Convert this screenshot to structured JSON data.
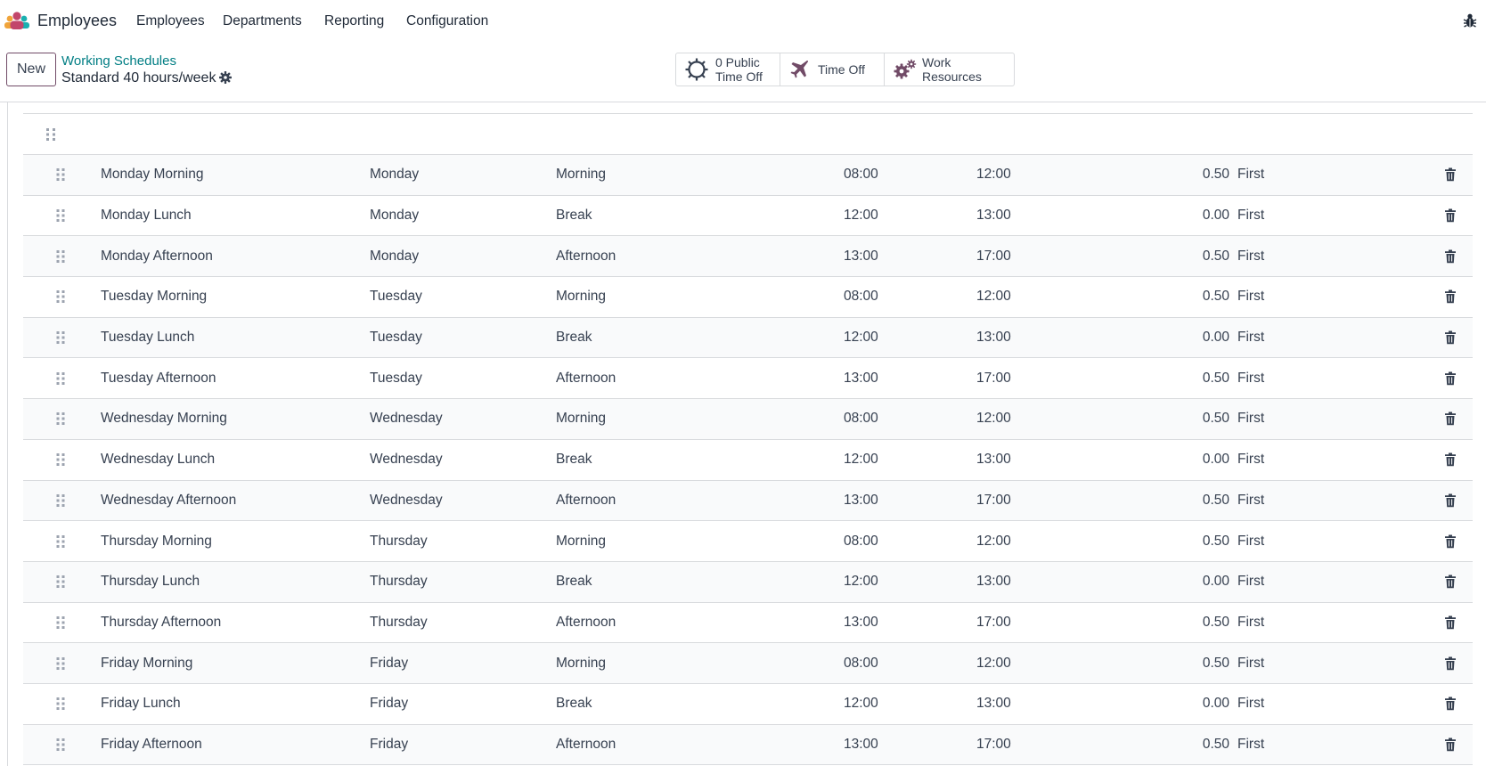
{
  "app": {
    "name": "Employees",
    "menu": [
      "Employees",
      "Departments",
      "Reporting",
      "Configuration"
    ],
    "brand_color": "#714b67"
  },
  "control_panel": {
    "new_label": "New",
    "breadcrumb_parent": "Working Schedules",
    "breadcrumb_current": "Standard 40 hours/week"
  },
  "stat_buttons": {
    "public_time_off": "0 Public\nTime Off",
    "public_time_off_line1": "0 Public",
    "public_time_off_line2": "Time Off",
    "time_off": "Time Off",
    "work_resources": "Work Resources"
  },
  "attendance_rows": [
    {
      "name": "Monday Morning",
      "day": "Monday",
      "period": "Morning",
      "from": "08:00",
      "to": "12:00",
      "duration": "0.50",
      "week": "First"
    },
    {
      "name": "Monday Lunch",
      "day": "Monday",
      "period": "Break",
      "from": "12:00",
      "to": "13:00",
      "duration": "0.00",
      "week": "First"
    },
    {
      "name": "Monday Afternoon",
      "day": "Monday",
      "period": "Afternoon",
      "from": "13:00",
      "to": "17:00",
      "duration": "0.50",
      "week": "First"
    },
    {
      "name": "Tuesday Morning",
      "day": "Tuesday",
      "period": "Morning",
      "from": "08:00",
      "to": "12:00",
      "duration": "0.50",
      "week": "First"
    },
    {
      "name": "Tuesday Lunch",
      "day": "Tuesday",
      "period": "Break",
      "from": "12:00",
      "to": "13:00",
      "duration": "0.00",
      "week": "First"
    },
    {
      "name": "Tuesday Afternoon",
      "day": "Tuesday",
      "period": "Afternoon",
      "from": "13:00",
      "to": "17:00",
      "duration": "0.50",
      "week": "First"
    },
    {
      "name": "Wednesday Morning",
      "day": "Wednesday",
      "period": "Morning",
      "from": "08:00",
      "to": "12:00",
      "duration": "0.50",
      "week": "First"
    },
    {
      "name": "Wednesday Lunch",
      "day": "Wednesday",
      "period": "Break",
      "from": "12:00",
      "to": "13:00",
      "duration": "0.00",
      "week": "First"
    },
    {
      "name": "Wednesday Afternoon",
      "day": "Wednesday",
      "period": "Afternoon",
      "from": "13:00",
      "to": "17:00",
      "duration": "0.50",
      "week": "First"
    },
    {
      "name": "Thursday Morning",
      "day": "Thursday",
      "period": "Morning",
      "from": "08:00",
      "to": "12:00",
      "duration": "0.50",
      "week": "First"
    },
    {
      "name": "Thursday Lunch",
      "day": "Thursday",
      "period": "Break",
      "from": "12:00",
      "to": "13:00",
      "duration": "0.00",
      "week": "First"
    },
    {
      "name": "Thursday Afternoon",
      "day": "Thursday",
      "period": "Afternoon",
      "from": "13:00",
      "to": "17:00",
      "duration": "0.50",
      "week": "First"
    },
    {
      "name": "Friday Morning",
      "day": "Friday",
      "period": "Morning",
      "from": "08:00",
      "to": "12:00",
      "duration": "0.50",
      "week": "First"
    },
    {
      "name": "Friday Lunch",
      "day": "Friday",
      "period": "Break",
      "from": "12:00",
      "to": "13:00",
      "duration": "0.00",
      "week": "First"
    },
    {
      "name": "Friday Afternoon",
      "day": "Friday",
      "period": "Afternoon",
      "from": "13:00",
      "to": "17:00",
      "duration": "0.50",
      "week": "First"
    }
  ],
  "icons": {
    "logo": "employees-app-icon",
    "debug": "bug-icon",
    "settings": "gear-icon",
    "public_time_off": "sun-icon",
    "time_off": "plane-icon",
    "work_resources": "cogs-icon",
    "drag": "drag-handle-icon",
    "delete": "trash-icon"
  }
}
